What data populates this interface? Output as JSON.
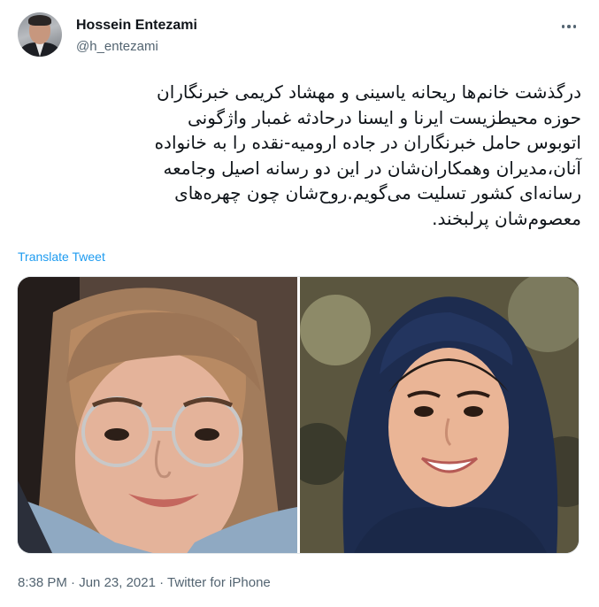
{
  "author": {
    "name": "Hossein Entezami",
    "handle": "@h_entezami"
  },
  "tweet": {
    "lines": [
      "درگذشت خانم‌ها ریحانه یاسینی و مهشاد کریمی خبرنگاران",
      "حوزه محیطزیست ایرنا و ایسنا درحادثه غمبار واژگونی",
      "اتوبوس حامل خبرنگاران در جاده ارومیه-نقده را به خانواده",
      "آنان،مدیران وهمکاران‌شان در این دو رسانه اصیل وجامعه",
      "رسانه‌ای کشور تسلیت می‌گویم.روح‌شان چون چهره‌های",
      "معصوم‌شان پرلبخند."
    ],
    "translate_label": "Translate Tweet"
  },
  "meta": {
    "time": "8:38 PM",
    "separator1": " · ",
    "date": "Jun 23, 2021",
    "separator2": " · ",
    "source": "Twitter for iPhone"
  },
  "icons": {
    "more": "more-horizontal-icon"
  },
  "colors": {
    "link": "#1d9bf0",
    "secondary_text": "#536471",
    "primary_text": "#0f1419"
  }
}
